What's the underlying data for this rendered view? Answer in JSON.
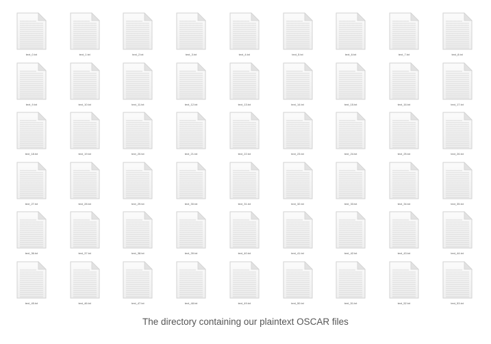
{
  "directory": {
    "files": [
      "text_0.txt",
      "text_1.txt",
      "text_2.txt",
      "text_3.txt",
      "text_4.txt",
      "text_5.txt",
      "text_6.txt",
      "text_7.txt",
      "text_8.txt",
      "text_9.txt",
      "text_10.txt",
      "text_11.txt",
      "text_12.txt",
      "text_13.txt",
      "text_14.txt",
      "text_15.txt",
      "text_16.txt",
      "text_17.txt",
      "text_18.txt",
      "text_19.txt",
      "text_20.txt",
      "text_21.txt",
      "text_22.txt",
      "text_23.txt",
      "text_24.txt",
      "text_25.txt",
      "text_26.txt",
      "text_27.txt",
      "text_28.txt",
      "text_29.txt",
      "text_30.txt",
      "text_31.txt",
      "text_32.txt",
      "text_33.txt",
      "text_34.txt",
      "text_35.txt",
      "text_36.txt",
      "text_37.txt",
      "text_38.txt",
      "text_39.txt",
      "text_40.txt",
      "text_41.txt",
      "text_42.txt",
      "text_43.txt",
      "text_44.txt",
      "text_45.txt",
      "text_46.txt",
      "text_47.txt",
      "text_48.txt",
      "text_49.txt",
      "text_50.txt",
      "text_51.txt",
      "text_52.txt",
      "text_53.txt"
    ],
    "icon": "text-document-icon"
  },
  "caption": "The directory containing our plaintext OSCAR files",
  "colors": {
    "page_fill": "#f6f6f6",
    "page_border": "#d2d2d2",
    "fold_fill": "#e2e2e2",
    "text_lines": "#d0d0d0",
    "caption": "#555555"
  }
}
